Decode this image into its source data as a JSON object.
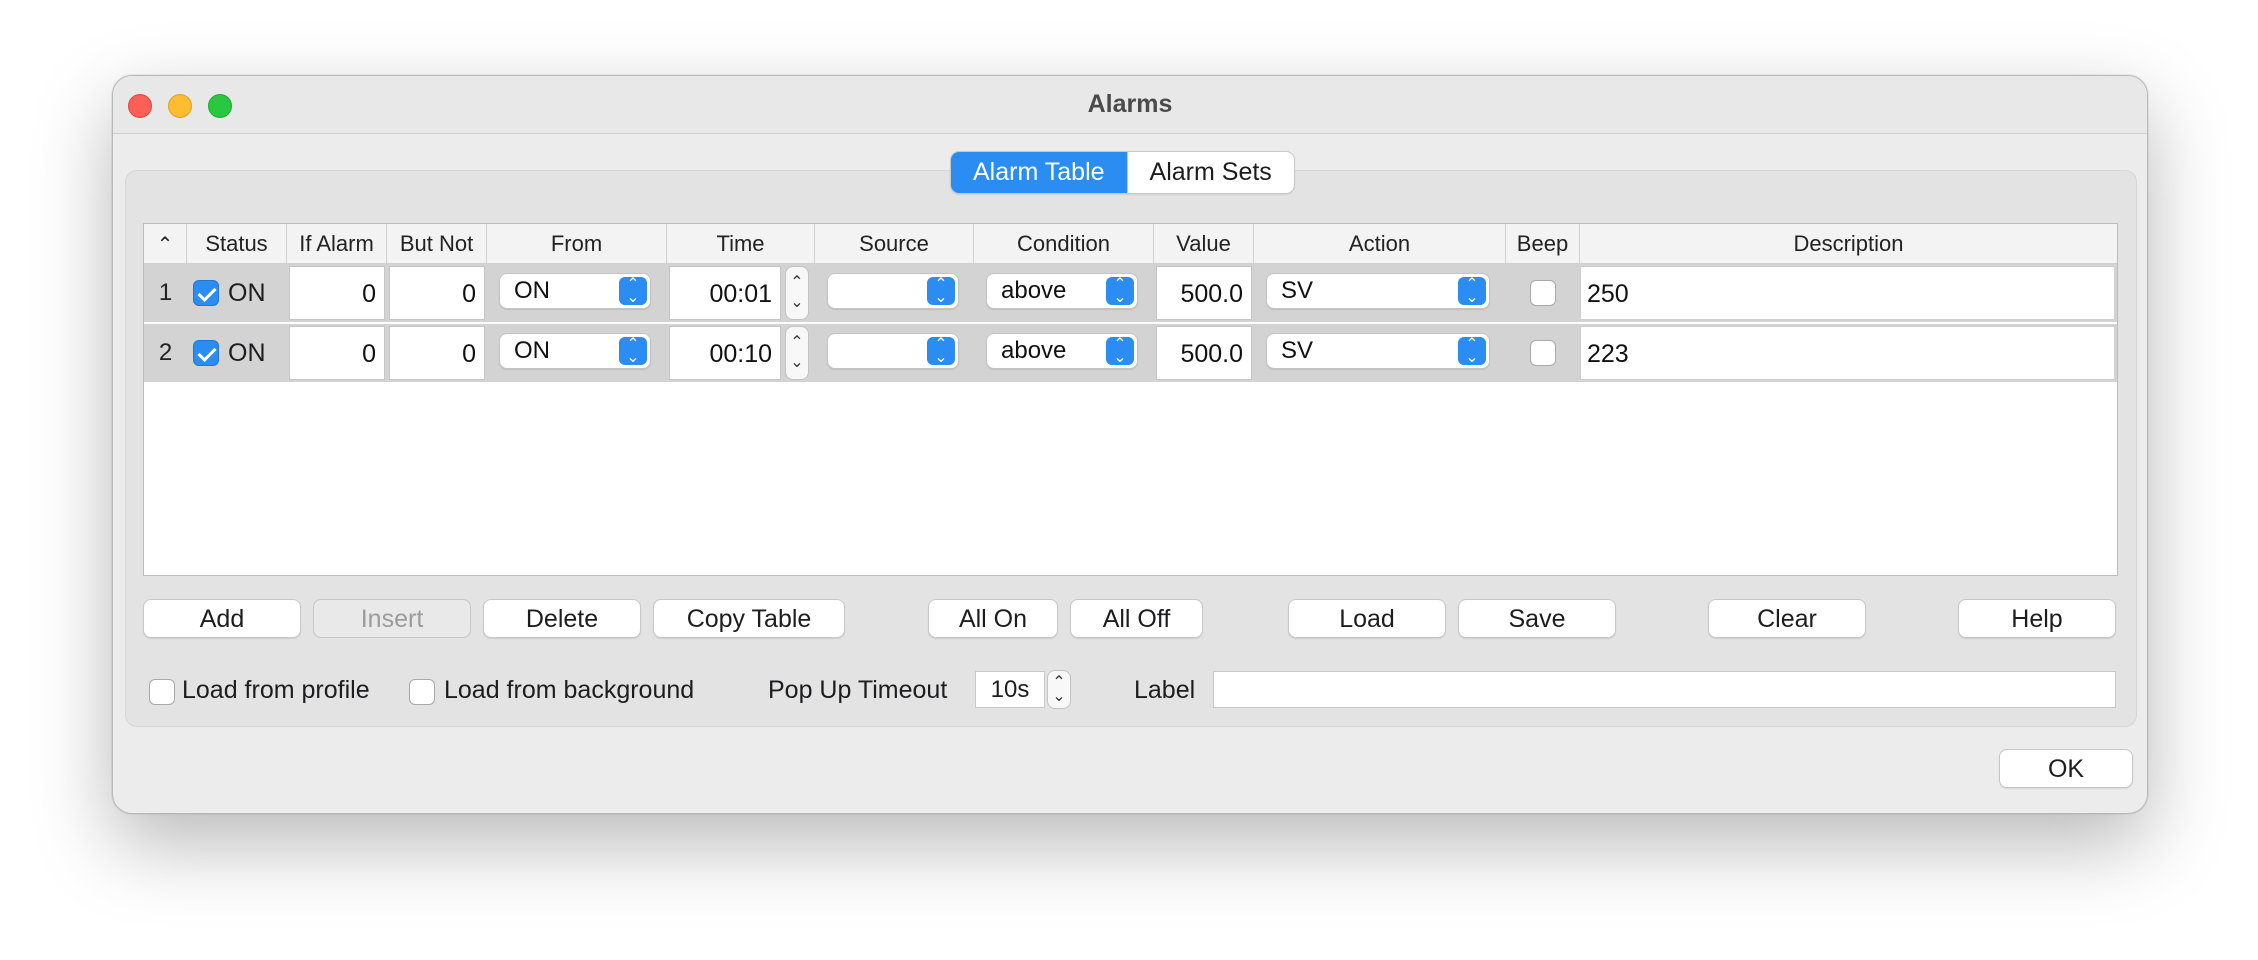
{
  "window": {
    "title": "Alarms"
  },
  "tabs": [
    {
      "label": "Alarm Table",
      "active": true
    },
    {
      "label": "Alarm Sets",
      "active": false
    }
  ],
  "table": {
    "sort_indicator": "^",
    "columns": [
      "Status",
      "If Alarm",
      "But Not",
      "From",
      "Time",
      "Source",
      "Condition",
      "Value",
      "Action",
      "Beep",
      "Description"
    ],
    "rows": [
      {
        "num": "1",
        "status_checked": true,
        "status": "ON",
        "if_alarm": "0",
        "but_not": "0",
        "from": "ON",
        "time": "00:01",
        "source": "",
        "condition": "above",
        "value": "500.0",
        "action": "SV",
        "beep": false,
        "description": "250"
      },
      {
        "num": "2",
        "status_checked": true,
        "status": "ON",
        "if_alarm": "0",
        "but_not": "0",
        "from": "ON",
        "time": "00:10",
        "source": "",
        "condition": "above",
        "value": "500.0",
        "action": "SV",
        "beep": false,
        "description": "223"
      }
    ]
  },
  "buttons": {
    "add": "Add",
    "insert": "Insert",
    "delete": "Delete",
    "copy_table": "Copy Table",
    "all_on": "All On",
    "all_off": "All Off",
    "load": "Load",
    "save": "Save",
    "clear": "Clear",
    "help": "Help",
    "ok": "OK"
  },
  "options": {
    "load_from_profile": "Load from profile",
    "load_from_background": "Load from background",
    "popup_timeout_label": "Pop Up Timeout",
    "popup_timeout_value": "10s",
    "label_label": "Label",
    "label_value": ""
  },
  "colors": {
    "accent": "#2b8cf1",
    "row_bg": "#d3d3d3"
  }
}
